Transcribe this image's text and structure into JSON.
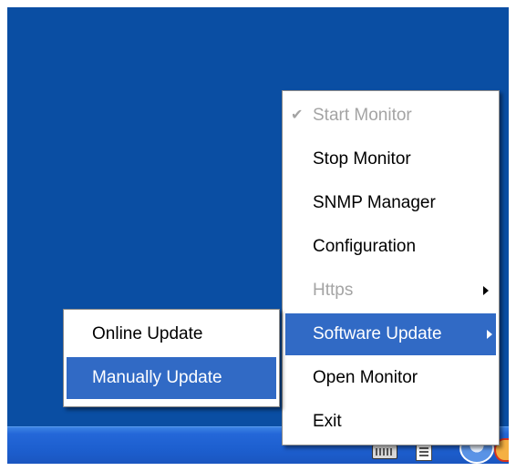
{
  "tray_menu": {
    "items": [
      {
        "label": "Start Monitor",
        "checked": true,
        "enabled": false
      },
      {
        "label": "Stop Monitor",
        "enabled": true
      },
      {
        "label": "SNMP Manager",
        "enabled": true
      },
      {
        "label": "Configuration",
        "enabled": true
      },
      {
        "label": "Https",
        "enabled": false,
        "has_submenu": true
      },
      {
        "label": "Software Update",
        "enabled": true,
        "has_submenu": true,
        "highlighted": true
      },
      {
        "label": "Open Monitor",
        "enabled": true
      },
      {
        "label": "Exit",
        "enabled": true
      }
    ]
  },
  "software_update_submenu": {
    "items": [
      {
        "label": "Online Update"
      },
      {
        "label": "Manually Update",
        "highlighted": true
      }
    ]
  },
  "icons": {
    "check": "checkmark-icon",
    "submenu_arrow": "submenu-arrow-icon",
    "tray": [
      "keyboard-icon",
      "document-icon",
      "security-shield-icon",
      "alert-icon"
    ]
  },
  "colors": {
    "desktop": "#0a4ea3",
    "taskbar": "#2467d8",
    "menu_background": "#ffffff",
    "highlight": "#316ac5",
    "disabled_text": "#a4a4a4"
  }
}
